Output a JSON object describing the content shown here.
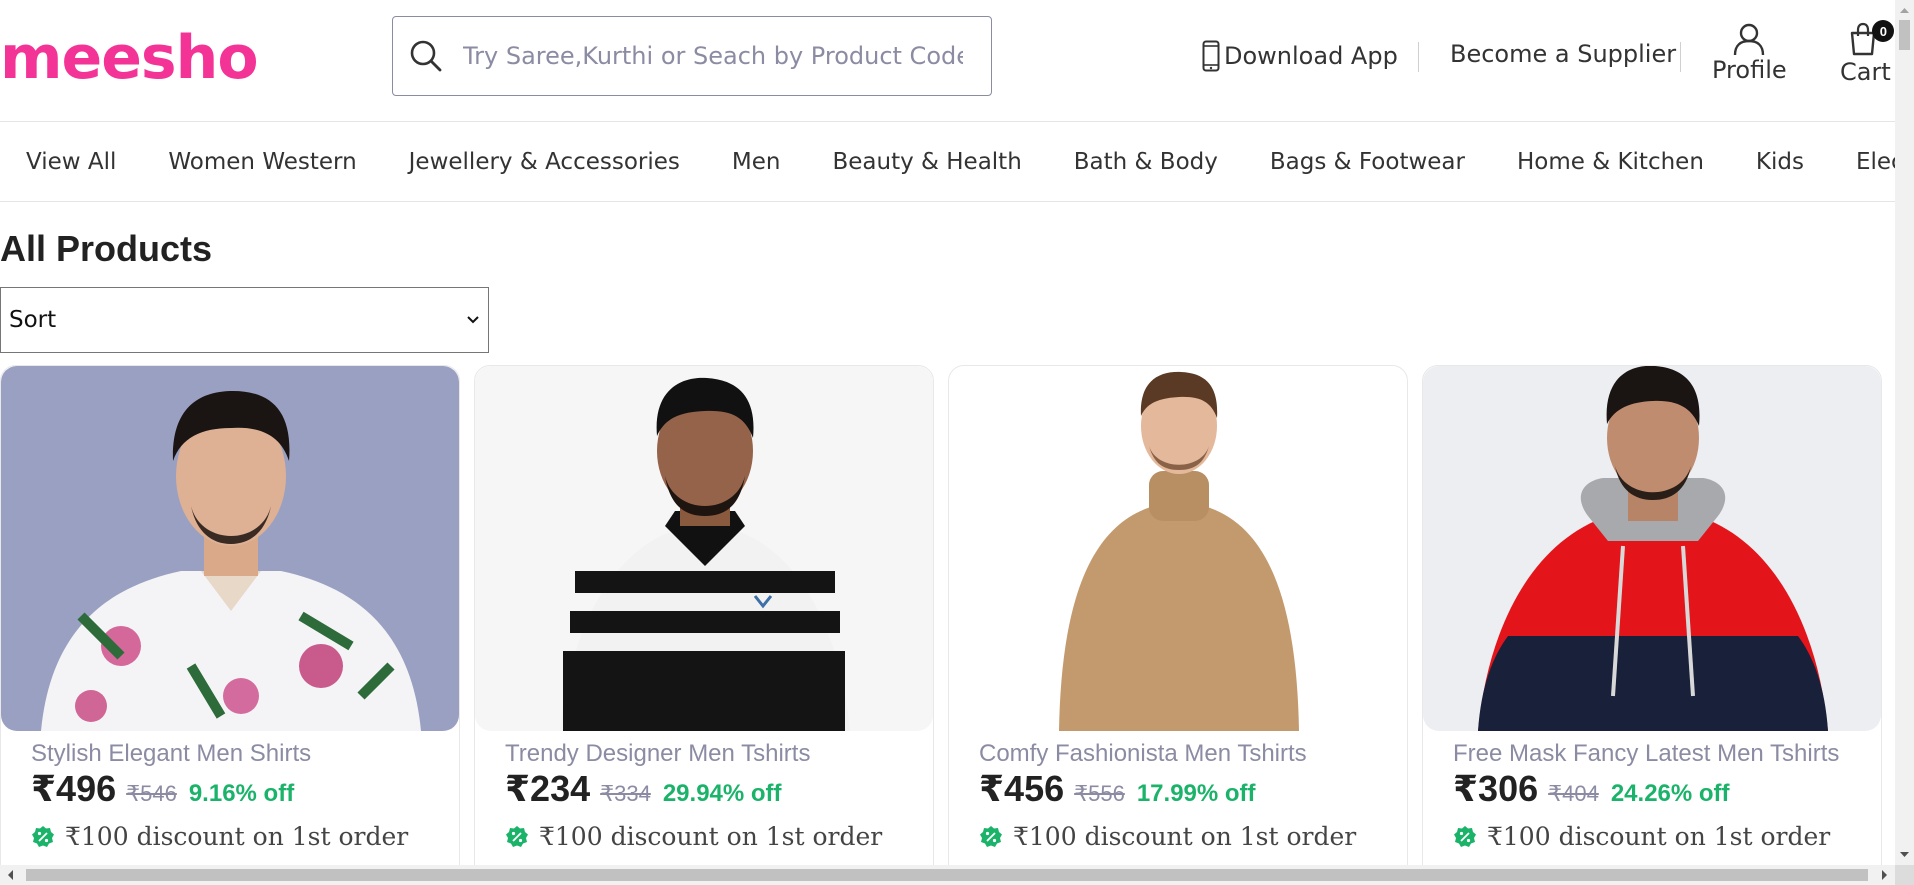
{
  "header": {
    "logo": "meesho",
    "search_placeholder": "Try Saree,Kurthi or Seach by Product Code",
    "download_app": "Download App",
    "become_supplier": "Become a Supplier",
    "profile": "Profile",
    "cart": "Cart",
    "cart_count": "0"
  },
  "categories": [
    "View All",
    "Women Western",
    "Jewellery & Accessories",
    "Men",
    "Beauty & Health",
    "Bath & Body",
    "Bags & Footwear",
    "Home & Kitchen",
    "Kids",
    "Electronics"
  ],
  "main": {
    "title": "All Products",
    "sort_label": "Sort"
  },
  "products": [
    {
      "name": "Stylish Elegant Men Shirts",
      "price": "₹496",
      "mrp": "₹546",
      "off": "9.16% off",
      "discount": "₹100 discount on 1st order"
    },
    {
      "name": "Trendy Designer Men Tshirts",
      "price": "₹234",
      "mrp": "₹334",
      "off": "29.94% off",
      "discount": "₹100 discount on 1st order"
    },
    {
      "name": "Comfy Fashionista Men Tshirts",
      "price": "₹456",
      "mrp": "₹556",
      "off": "17.99% off",
      "discount": "₹100 discount on 1st order"
    },
    {
      "name": "Free Mask Fancy Latest Men Tshirts",
      "price": "₹306",
      "mrp": "₹404",
      "off": "24.26% off",
      "discount": "₹100 discount on 1st order"
    }
  ],
  "colors": {
    "brand": "#f43397",
    "discount_green": "#1bb36a",
    "muted": "#8b8ba3"
  }
}
